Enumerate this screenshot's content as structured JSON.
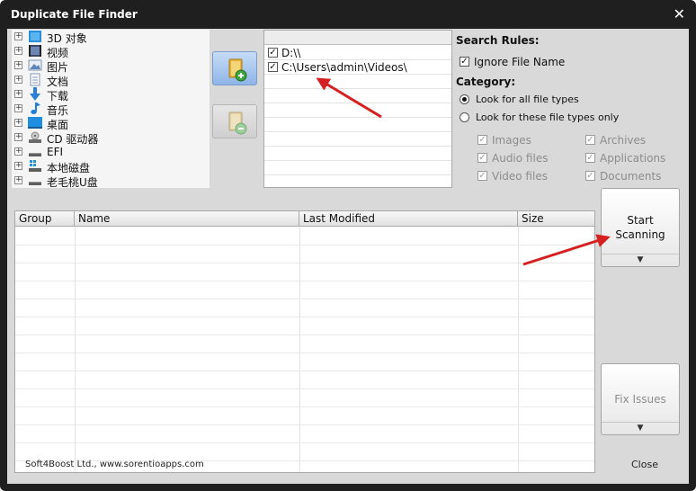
{
  "window": {
    "title": "Duplicate File Finder",
    "close_glyph": "✕"
  },
  "tree": {
    "expander_glyph": "+",
    "items": [
      {
        "label": "3D 对象",
        "icon": "3d-objects-icon"
      },
      {
        "label": "视频",
        "icon": "video-folder-icon"
      },
      {
        "label": "图片",
        "icon": "pictures-folder-icon"
      },
      {
        "label": "文档",
        "icon": "documents-folder-icon"
      },
      {
        "label": "下载",
        "icon": "download-folder-icon"
      },
      {
        "label": "音乐",
        "icon": "music-folder-icon"
      },
      {
        "label": "桌面",
        "icon": "desktop-icon"
      },
      {
        "label": "CD 驱动器",
        "icon": "cd-drive-icon"
      },
      {
        "label": "EFI",
        "icon": "drive-icon"
      },
      {
        "label": "本地磁盘",
        "icon": "local-disk-icon"
      },
      {
        "label": "老毛桃U盘",
        "icon": "usb-drive-icon"
      }
    ]
  },
  "paths": {
    "check_glyph": "✓",
    "items": [
      {
        "path": "D:\\\\",
        "checked": true
      },
      {
        "path": "C:\\Users\\admin\\Videos\\",
        "checked": true
      }
    ]
  },
  "rules": {
    "search_rules_heading": "Search Rules:",
    "ignore_file_name_label": "Ignore File Name",
    "category_heading": "Category:",
    "all_types_label": "Look for all file types",
    "these_types_label": "Look for these file types only",
    "types": [
      {
        "label": "Images"
      },
      {
        "label": "Archives"
      },
      {
        "label": "Audio files"
      },
      {
        "label": "Applications"
      },
      {
        "label": "Video files"
      },
      {
        "label": "Documents"
      }
    ]
  },
  "table": {
    "columns": [
      "Group",
      "Name",
      "Last Modified",
      "Size"
    ]
  },
  "actions": {
    "start_line1": "Start",
    "start_line2": "Scanning",
    "fix_label": "Fix Issues",
    "split_glyph": "▼"
  },
  "footer": {
    "company": "Soft4Boost Ltd., www.sorentioapps.com",
    "close_label": "Close"
  },
  "colors": {
    "annotation_arrow": "#d42020",
    "window_frame": "#1f1f1f",
    "client_bg": "#d9d9d9"
  }
}
